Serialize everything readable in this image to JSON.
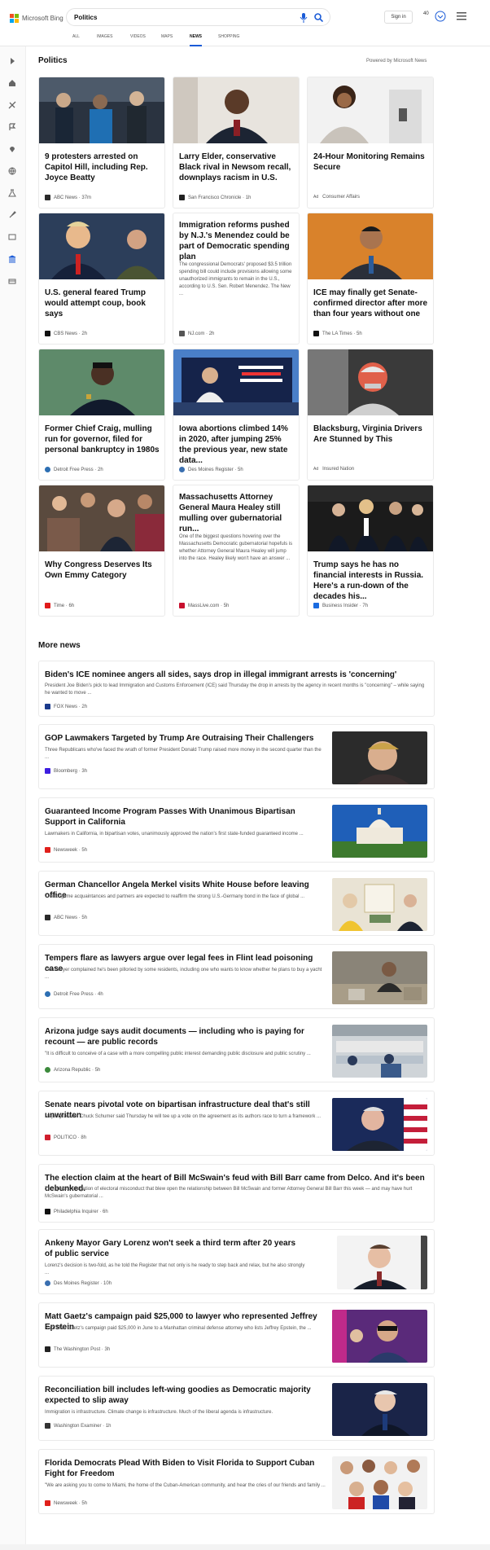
{
  "header": {
    "logo_text": "Microsoft Bing",
    "query": "Politics",
    "signin": "Sign in",
    "rewards": "40"
  },
  "tabs": [
    "ALL",
    "IMAGES",
    "VIDEOS",
    "MAPS",
    "NEWS",
    "SHOPPING"
  ],
  "section": {
    "title": "Politics",
    "powered": "Powered by Microsoft News"
  },
  "cards": [
    {
      "title": "9 protesters arrested on Capitol Hill, including Rep. Joyce Beatty",
      "source": "ABC News",
      "time": "37m",
      "fav": "#2a2a2a"
    },
    {
      "title": "Larry Elder, conservative Black rival in Newsom recall, downplays racism in U.S.",
      "source": "San Francisco Chronicle",
      "time": "1h",
      "fav": "#222"
    },
    {
      "title": "24-Hour Monitoring Remains Secure",
      "source": "Consumer Affairs",
      "ad": "Ad",
      "fav": ""
    },
    {
      "title": "U.S. general feared Trump would attempt coup, book says",
      "source": "CBS News",
      "time": "2h",
      "fav": "#111"
    },
    {
      "title": "Immigration reforms pushed by N.J.'s Menendez could be part of Democratic spending plan",
      "snippet": "The congressional Democrats' proposed $3.5 trillion spending bill could include provisions allowing some unauthorized immigrants to remain in the U.S., according to U.S. Sen. Robert Menendez. The New ...",
      "source": "NJ.com",
      "time": "2h",
      "fav": "#555"
    },
    {
      "title": "ICE may finally get Senate-confirmed director after more than four years without one",
      "source": "The LA Times",
      "time": "5h",
      "fav": "#111"
    },
    {
      "title": "Former Chief Craig, mulling run for governor, filed for personal bankruptcy in 1980s",
      "source": "Detroit Free Press",
      "time": "2h",
      "fav": "#2d6fb3"
    },
    {
      "title": "Iowa abortions climbed 14% in 2020, after jumping 25% the previous year, new state data...",
      "source": "Des Moines Register",
      "time": "5h",
      "fav": "#3a6fb0"
    },
    {
      "title": "Blacksburg, Virginia Drivers Are Stunned by This",
      "source": "Insured Nation",
      "ad": "Ad",
      "fav": ""
    },
    {
      "title": "Why Congress Deserves Its Own Emmy Category",
      "source": "Time",
      "time": "6h",
      "fav": "#e01b1b"
    },
    {
      "title": "Massachusetts Attorney General Maura Healey still mulling over gubernatorial run...",
      "snippet": "One of the biggest questions hovering over the Massachusetts Democratic gubernatorial hopefuls is whether Attorney General Maura Healey will jump into the race. Healey likely won't have an answer ...",
      "source": "MassLive.com",
      "time": "5h",
      "fav": "#c8102e"
    },
    {
      "title": "Trump says he has no financial interests in Russia. Here's a run-down of the decades his...",
      "source": "Business Insider",
      "time": "7h",
      "fav": "#1a6be0"
    }
  ],
  "more_title": "More news",
  "more": [
    {
      "title": "Biden's ICE nominee angers all sides, says drop in illegal immigrant arrests is 'concerning'",
      "desc": "President Joe Biden's pick to lead Immigration and Customs Enforcement (ICE) said Thursday the drop in arrests by the agency in recent months is \"concerning\" – while saying he wanted to move ...",
      "source": "FOX News",
      "time": "2h",
      "fav": "#1b3a8c"
    },
    {
      "title": "GOP Lawmakers Targeted by Trump Are Outraising Their Challengers",
      "desc": "Three Republicans who've faced the wrath of former President Donald Trump raised more money in the second quarter than the ...",
      "source": "Bloomberg",
      "time": "3h",
      "fav": "#3d1ee0"
    },
    {
      "title": "Guaranteed Income Program Passes With Unanimous Bipartisan Support in California",
      "desc": "Lawmakers in California, in bipartisan votes, unanimously approved the nation's first state-funded guaranteed income ...",
      "source": "Newsweek",
      "time": "5h",
      "fav": "#e0201b"
    },
    {
      "title": "German Chancellor Angela Merkel visits White House before leaving office",
      "desc": "The longtime acquaintances and partners are expected to reaffirm the strong U.S.-Germany bond in the face of global ...",
      "source": "ABC News",
      "time": "5h",
      "fav": "#2a2a2a"
    },
    {
      "title": "Tempers flare as lawyers argue over legal fees in Flint lead poisoning case",
      "desc": "One lawyer complained he's been pilloried by some residents, including one who wants to know whether he plans to buy a yacht ...",
      "source": "Detroit Free Press",
      "time": "4h",
      "fav": "#2d6fb3"
    },
    {
      "title": "Arizona judge says audit documents — including who is paying for recount — are public records",
      "desc": "\"It is difficult to conceive of a case with a more compelling public interest demanding public disclosure and public scrutiny ...",
      "source": "Arizona Republic",
      "time": "5h",
      "fav": "#3c8a3c"
    },
    {
      "title": "Senate nears pivotal vote on bipartisan infrastructure deal that's still unwritten",
      "desc": "Majority Leader Chuck Schumer said Thursday he will tee up a vote on the agreement as its authors race to turn a framework ...",
      "source": "POLITICO",
      "time": "8h",
      "fav": "#d01f2e"
    },
    {
      "title": "The election claim at the heart of Bill McSwain's feud with Bill Barr came from Delco. And it's been debunked.",
      "desc": "The specific allegation of electoral misconduct that blew open the relationship between Bill McSwain and former Attorney General Bill Barr this week — and may have hurt McSwain's gubernatorial ...",
      "source": "Philadelphia Inquirer",
      "time": "6h",
      "fav": "#111"
    },
    {
      "title": "Ankeny Mayor Gary Lorenz won't seek a third term after 20 years of public service",
      "desc": "Lorenz's decision is two-fold, as he told the Register that not only is he ready to step back and relax, but he also strongly ...",
      "source": "Des Moines Register",
      "time": "10h",
      "fav": "#3a6fb0"
    },
    {
      "title": "Matt Gaetz's campaign paid $25,000 to lawyer who represented Jeffrey Epstein",
      "desc": "Rep. Matt Gaetz's campaign paid $25,000 in June to a Manhattan criminal defense attorney who lists Jeffrey Epstein, the ...",
      "source": "The Washington Post",
      "time": "3h",
      "fav": "#222"
    },
    {
      "title": "Reconciliation bill includes left-wing goodies as Democratic majority expected to slip away",
      "desc": "Immigration is infrastructure. Climate change is infrastructure. Much of the liberal agenda is infrastructure.",
      "source": "Washington Examiner",
      "time": "1h",
      "fav": "#333"
    },
    {
      "title": "Florida Democrats Plead With Biden to Visit Florida to Support Cuban Fight for Freedom",
      "desc": "\"We are asking you to come to Miami, the home of the Cuban-American community, and hear the cries of our friends and family ...",
      "source": "Newsweek",
      "time": "5h",
      "fav": "#e0201b"
    }
  ]
}
